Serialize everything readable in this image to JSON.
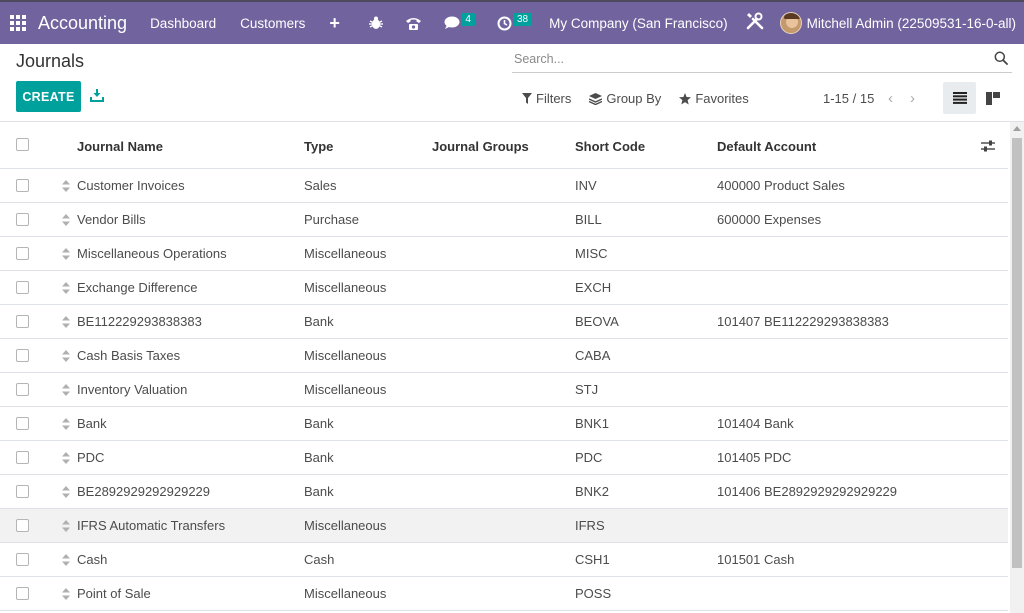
{
  "navbar": {
    "app_name": "Accounting",
    "menu": [
      "Dashboard",
      "Customers"
    ],
    "plus": "+",
    "messages_count": "4",
    "activities_count": "38",
    "company": "My Company (San Francisco)",
    "user": "Mitchell Admin (22509531-16-0-all)"
  },
  "control": {
    "title": "Journals",
    "search_placeholder": "Search...",
    "create_label": "CREATE",
    "filters_label": "Filters",
    "groupby_label": "Group By",
    "favorites_label": "Favorites",
    "pager": "1-15 / 15"
  },
  "table": {
    "columns": [
      "Journal Name",
      "Type",
      "Journal Groups",
      "Short Code",
      "Default Account"
    ],
    "rows": [
      {
        "name": "Customer Invoices",
        "type": "Sales",
        "groups": "",
        "code": "INV",
        "account": "400000 Product Sales"
      },
      {
        "name": "Vendor Bills",
        "type": "Purchase",
        "groups": "",
        "code": "BILL",
        "account": "600000 Expenses"
      },
      {
        "name": "Miscellaneous Operations",
        "type": "Miscellaneous",
        "groups": "",
        "code": "MISC",
        "account": ""
      },
      {
        "name": "Exchange Difference",
        "type": "Miscellaneous",
        "groups": "",
        "code": "EXCH",
        "account": ""
      },
      {
        "name": "BE112229293838383",
        "type": "Bank",
        "groups": "",
        "code": "BEOVA",
        "account": "101407 BE112229293838383"
      },
      {
        "name": "Cash Basis Taxes",
        "type": "Miscellaneous",
        "groups": "",
        "code": "CABA",
        "account": ""
      },
      {
        "name": "Inventory Valuation",
        "type": "Miscellaneous",
        "groups": "",
        "code": "STJ",
        "account": ""
      },
      {
        "name": "Bank",
        "type": "Bank",
        "groups": "",
        "code": "BNK1",
        "account": "101404 Bank"
      },
      {
        "name": "PDC",
        "type": "Bank",
        "groups": "",
        "code": "PDC",
        "account": "101405 PDC"
      },
      {
        "name": "BE2892929292929229",
        "type": "Bank",
        "groups": "",
        "code": "BNK2",
        "account": "101406 BE2892929292929229"
      },
      {
        "name": "IFRS Automatic Transfers",
        "type": "Miscellaneous",
        "groups": "",
        "code": "IFRS",
        "account": ""
      },
      {
        "name": "Cash",
        "type": "Cash",
        "groups": "",
        "code": "CSH1",
        "account": "101501 Cash"
      },
      {
        "name": "Point of Sale",
        "type": "Miscellaneous",
        "groups": "",
        "code": "POSS",
        "account": ""
      }
    ]
  },
  "colors": {
    "navbar": "#71639e",
    "primary": "#00a09d",
    "row_highlight": "#f2f2f2"
  }
}
